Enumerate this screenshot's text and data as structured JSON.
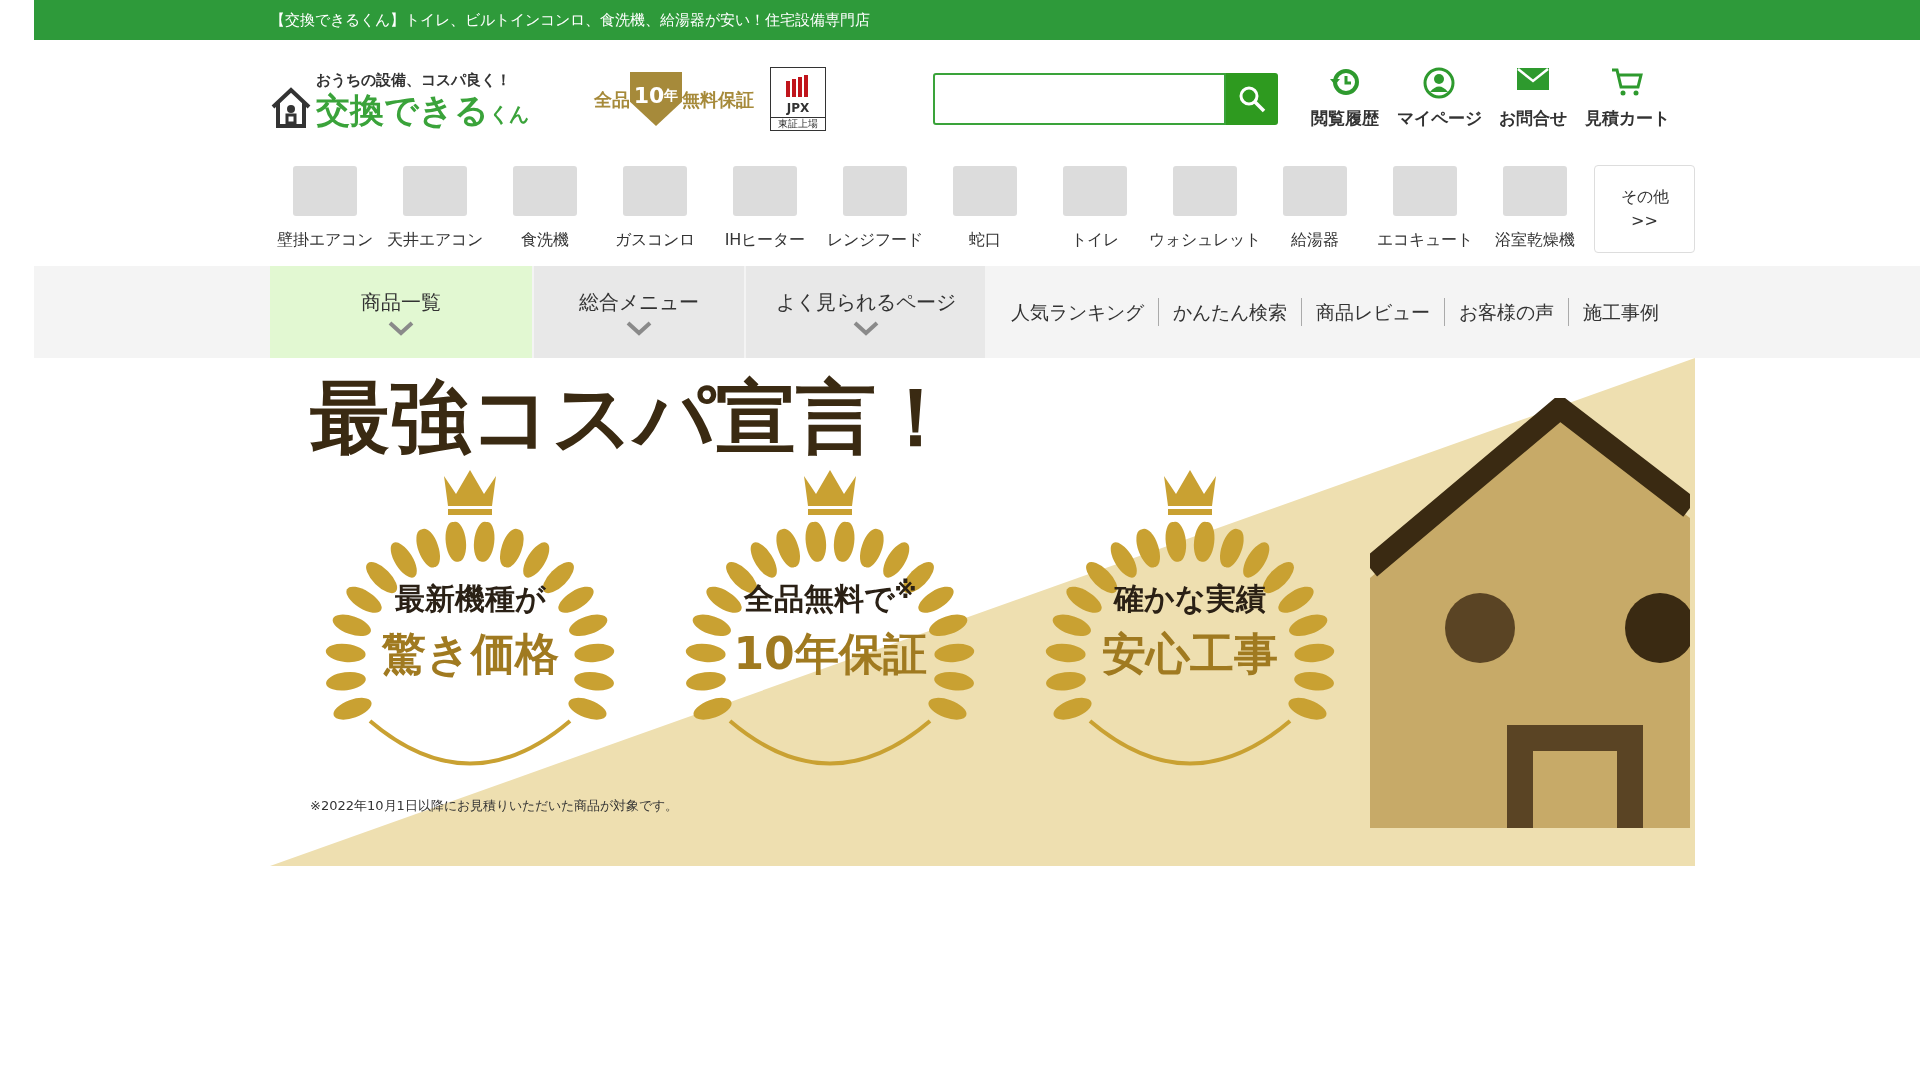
{
  "top_bar": {
    "text": "【交換できるくん】トイレ、ビルトインコンロ、食洗機、給湯器が安い！住宅設備専門店"
  },
  "header": {
    "logo": {
      "tagline": "おうちの設備、コスパ良く！",
      "name": "交換できる",
      "suffix": "くん"
    },
    "warranty": {
      "prefix": "全品",
      "years": "10",
      "unit": "年",
      "suffix": "無料保証"
    },
    "listing": {
      "code": "JPX",
      "market": "東証上場"
    },
    "links": [
      {
        "kind": "history",
        "label": "閲覧履歴"
      },
      {
        "kind": "user",
        "label": "マイページ"
      },
      {
        "kind": "mail",
        "label": "お問合せ"
      },
      {
        "kind": "cart",
        "label": "見積カート"
      }
    ]
  },
  "categories": [
    {
      "label": "壁掛エアコン"
    },
    {
      "label": "天井エアコン"
    },
    {
      "label": "食洗機"
    },
    {
      "label": "ガスコンロ"
    },
    {
      "label": "IHヒーター"
    },
    {
      "label": "レンジフード"
    },
    {
      "label": "蛇口"
    },
    {
      "label": "トイレ"
    },
    {
      "label": "ウォシュレット"
    },
    {
      "label": "給湯器"
    },
    {
      "label": "エコキュート"
    },
    {
      "label": "浴室乾燥機"
    }
  ],
  "more": {
    "label": "その他",
    "arrow": ">>"
  },
  "nav": {
    "tabs": [
      {
        "label": "商品一覧",
        "selected": true
      },
      {
        "label": "総合メニュー",
        "selected": false
      },
      {
        "label": "よく見られるページ",
        "selected": false
      }
    ],
    "links": [
      "人気ランキング",
      "かんたん検索",
      "商品レビュー",
      "お客様の声",
      "施工事例"
    ]
  },
  "banner": {
    "headline": "最強コスパ宣言！",
    "awards": [
      {
        "line1": "最新機種が",
        "line2": "驚き価格"
      },
      {
        "line1": "全品無料で$^{※}$",
        "line2": "10年保証"
      },
      {
        "line1": "確かな実績",
        "line2": "安心工事"
      }
    ],
    "footnote": "※2022年10月1日以降にお見積りいただいた商品が対象です。"
  }
}
